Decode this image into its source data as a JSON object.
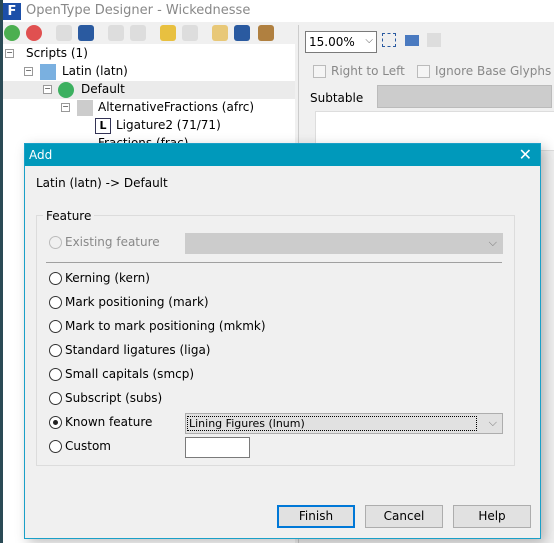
{
  "app": {
    "title": "OpenType Designer - Wickednesse"
  },
  "tree": {
    "items": [
      {
        "label": "Scripts (1)"
      },
      {
        "label": "Latin (latn)"
      },
      {
        "label": "Default"
      },
      {
        "label": "AlternativeFractions (afrc)"
      },
      {
        "label": "Ligature2 (71/71)"
      },
      {
        "label": "Fractions (frac)"
      }
    ]
  },
  "right": {
    "zoom": "15.00%",
    "right_to_left": "Right to Left",
    "ignore_base": "Ignore Base Glyphs",
    "subtable_label": "Subtable"
  },
  "dialog": {
    "title": "Add",
    "path": "Latin (latn) -> Default",
    "group_label": "Feature",
    "existing": "Existing feature",
    "options": [
      "Kerning (kern)",
      "Mark positioning (mark)",
      "Mark to mark positioning (mkmk)",
      "Standard ligatures (liga)",
      "Small capitals (smcp)",
      "Subscript (subs)"
    ],
    "known": "Known feature",
    "known_value": "Lining Figures (lnum)",
    "custom": "Custom",
    "custom_value": "",
    "finish": "Finish",
    "cancel": "Cancel",
    "help": "Help",
    "selected": "Known feature"
  },
  "colors": {
    "accent": "#0099bb",
    "focus": "#0078d7"
  }
}
